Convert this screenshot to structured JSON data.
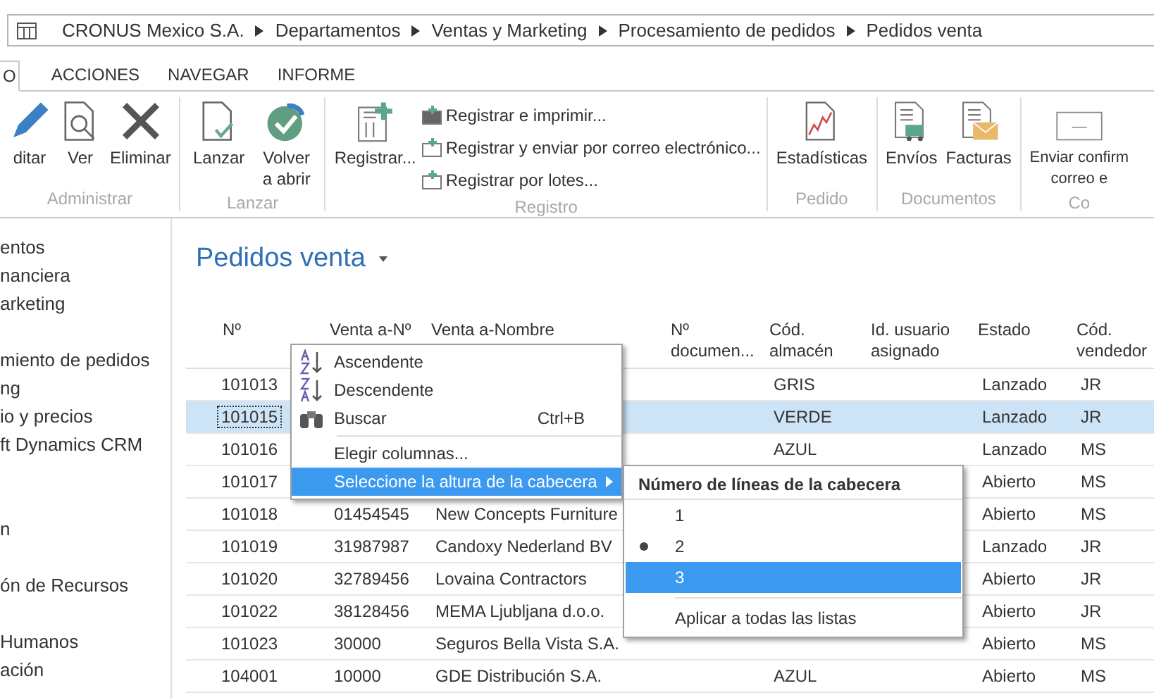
{
  "breadcrumb": {
    "items": [
      "CRONUS Mexico S.A.",
      "Departamentos",
      "Ventas y Marketing",
      "Procesamiento de pedidos",
      "Pedidos venta"
    ]
  },
  "ribbon": {
    "tabs": [
      {
        "label": "O",
        "selected": true
      },
      {
        "label": "ACCIONES",
        "selected": false
      },
      {
        "label": "NAVEGAR",
        "selected": false
      },
      {
        "label": "INFORME",
        "selected": false
      }
    ],
    "groups": [
      {
        "label": "Administrar",
        "buttons": [
          {
            "label": "ditar",
            "kind": "large"
          },
          {
            "label": "Ver",
            "kind": "large"
          },
          {
            "label": "Eliminar",
            "kind": "large"
          }
        ]
      },
      {
        "label": "Lanzar",
        "buttons": [
          {
            "label": "Lanzar",
            "kind": "large"
          },
          {
            "label": "Volver a abrir",
            "kind": "large"
          }
        ]
      },
      {
        "label": "Registro",
        "buttons": [
          {
            "label": "Registrar...",
            "kind": "large"
          },
          {
            "label": "Registrar e imprimir...",
            "kind": "small"
          },
          {
            "label": "Registrar y enviar por correo electrónico...",
            "kind": "small"
          },
          {
            "label": "Registrar por lotes...",
            "kind": "small"
          }
        ]
      },
      {
        "label": "Pedido",
        "buttons": [
          {
            "label": "Estadísticas",
            "kind": "large"
          }
        ]
      },
      {
        "label": "Documentos",
        "buttons": [
          {
            "label": "Envíos",
            "kind": "large"
          },
          {
            "label": "Facturas",
            "kind": "large"
          }
        ]
      },
      {
        "label": "Co",
        "buttons": [
          {
            "label": "Enviar confirm correo e",
            "kind": "large"
          }
        ]
      }
    ]
  },
  "sidebar": {
    "sections": [
      [
        "entos",
        "nanciera",
        "arketing"
      ],
      [
        "miento de pedidos",
        "ng",
        "io y precios",
        "ft Dynamics CRM"
      ],
      [
        "n"
      ],
      [
        "ón de Recursos"
      ],
      [
        "Humanos",
        "ación"
      ]
    ]
  },
  "page": {
    "title": "Pedidos venta"
  },
  "table": {
    "columns": [
      "Nº",
      "Venta a-Nº",
      "Venta a-Nombre",
      "Nº documen...",
      "Cód. almacén",
      "Id. usuario asignado",
      "Estado",
      "Cód. vendedor"
    ],
    "rows": [
      {
        "selected": false,
        "cells": [
          "101013",
          "",
          "",
          "",
          "GRIS",
          "",
          "Lanzado",
          "JR"
        ]
      },
      {
        "selected": true,
        "cells": [
          "101015",
          "",
          "",
          "",
          "VERDE",
          "",
          "Lanzado",
          "JR"
        ]
      },
      {
        "selected": false,
        "cells": [
          "101016",
          "",
          "",
          "",
          "AZUL",
          "",
          "Lanzado",
          "MS"
        ]
      },
      {
        "selected": false,
        "cells": [
          "101017",
          "",
          "",
          "",
          "",
          "",
          "Abierto",
          "MS"
        ]
      },
      {
        "selected": false,
        "cells": [
          "101018",
          "01454545",
          "New Concepts Furniture",
          "",
          "",
          "",
          "Abierto",
          "MS"
        ]
      },
      {
        "selected": false,
        "cells": [
          "101019",
          "31987987",
          "Candoxy Nederland BV",
          "",
          "",
          "",
          "Lanzado",
          "JR"
        ]
      },
      {
        "selected": false,
        "cells": [
          "101020",
          "32789456",
          "Lovaina Contractors",
          "",
          "",
          "",
          "Abierto",
          "JR"
        ]
      },
      {
        "selected": false,
        "cells": [
          "101022",
          "38128456",
          "MEMA Ljubljana d.o.o.",
          "",
          "",
          "",
          "Abierto",
          "JR"
        ]
      },
      {
        "selected": false,
        "cells": [
          "101023",
          "30000",
          "Seguros Bella Vista S.A.",
          "",
          "",
          "",
          "Abierto",
          "MS"
        ]
      },
      {
        "selected": false,
        "cells": [
          "104001",
          "10000",
          "GDE Distribución S.A.",
          "",
          "AZUL",
          "",
          "Abierto",
          "MS"
        ]
      }
    ]
  },
  "context_menu": {
    "items": [
      {
        "kind": "sort_ascending",
        "label": "Ascendente",
        "highlighted": false
      },
      {
        "kind": "sort_descending",
        "label": "Descendente",
        "highlighted": false
      },
      {
        "kind": "find",
        "label": "Buscar",
        "shortcut": "Ctrl+B",
        "highlighted": false
      },
      {
        "kind": "separator"
      },
      {
        "kind": "plain",
        "label": "Elegir columnas...",
        "highlighted": false
      },
      {
        "kind": "submenu",
        "label": "Seleccione la altura de la cabecera",
        "highlighted": true
      }
    ]
  },
  "submenu": {
    "title": "Número de líneas de la cabecera",
    "options": [
      {
        "label": "1",
        "selected": false,
        "highlighted": false
      },
      {
        "label": "2",
        "selected": true,
        "highlighted": false
      },
      {
        "label": "3",
        "selected": false,
        "highlighted": true
      }
    ],
    "footer": "Aplicar a todas las listas"
  }
}
